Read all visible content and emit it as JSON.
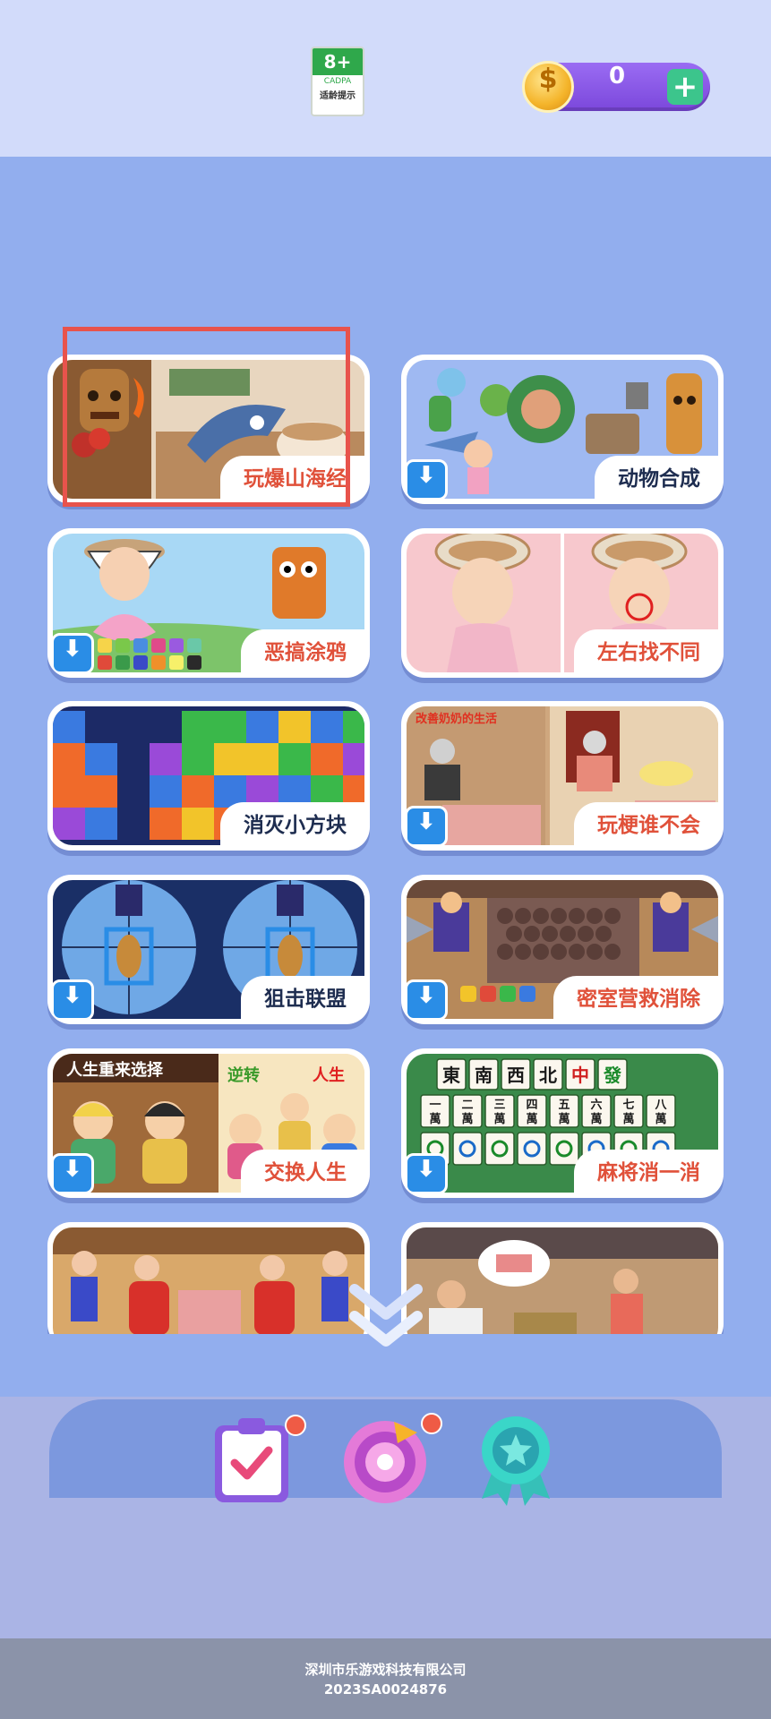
{
  "age_badge": {
    "rating": "8+",
    "org": "CADPA",
    "tip": "适龄提示"
  },
  "wallet": {
    "coin_symbol": "$",
    "coins": "0",
    "add_symbol": "+"
  },
  "games": [
    {
      "title": "玩爆山海经"
    },
    {
      "title": "动物合成"
    },
    {
      "title": "恶搞涂鸦"
    },
    {
      "title": "左右找不同"
    },
    {
      "title": "消灭小方块"
    },
    {
      "title": "玩梗谁不会"
    },
    {
      "title": "狙击联盟"
    },
    {
      "title": "密室营救消除"
    },
    {
      "title": "交换人生"
    },
    {
      "title": "麻将消一消"
    }
  ],
  "card_art_text": {
    "grandma": "改善奶奶的生活",
    "life_left": "人生重来选择",
    "life_reverse": "逆转",
    "life_right": "人生",
    "mahjong_winds": [
      "東",
      "南",
      "西",
      "北",
      "中",
      "發"
    ],
    "mahjong_nums": [
      "一",
      "二",
      "三",
      "四",
      "五",
      "六",
      "七",
      "八"
    ],
    "mahjong_wan": "萬"
  },
  "download_symbol": "⬇",
  "footer": {
    "company": "深圳市乐游戏科技有限公司",
    "code": "2023SA0024876"
  }
}
